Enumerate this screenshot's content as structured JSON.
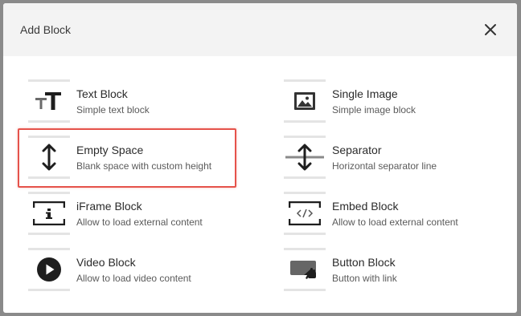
{
  "modal": {
    "title": "Add Block",
    "close_icon": "close-icon"
  },
  "blocks": [
    {
      "title": "Text Block",
      "desc": "Simple text block",
      "icon": "text-icon"
    },
    {
      "title": "Single Image",
      "desc": "Simple image block",
      "icon": "image-icon"
    },
    {
      "title": "Empty Space",
      "desc": "Blank space with custom height",
      "icon": "vertical-arrows-icon"
    },
    {
      "title": "Separator",
      "desc": "Horizontal separator line",
      "icon": "separator-icon"
    },
    {
      "title": "iFrame Block",
      "desc": "Allow to load external content",
      "icon": "iframe-icon"
    },
    {
      "title": "Embed Block",
      "desc": "Allow to load external content",
      "icon": "embed-code-icon"
    },
    {
      "title": "Video Block",
      "desc": "Allow to load video content",
      "icon": "play-icon"
    },
    {
      "title": "Button Block",
      "desc": "Button with link",
      "icon": "button-pointer-icon"
    }
  ],
  "colors": {
    "highlight": "#e5534b",
    "header_bg": "#f3f3f3",
    "icon_dark": "#1e1e1e"
  }
}
